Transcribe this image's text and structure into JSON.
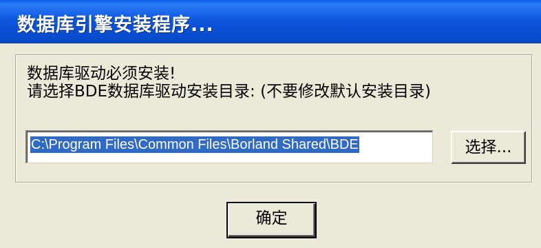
{
  "window": {
    "title": "数据库引擎安装程序..."
  },
  "content": {
    "message_line1": "数据库驱动必须安装!",
    "message_line2": "请选择BDE数据库驱动安装目录: (不要修改默认安装目录)"
  },
  "path_field": {
    "value": "C:\\Program Files\\Common Files\\Borland Shared\\BDE"
  },
  "buttons": {
    "browse_label": "选择...",
    "ok_label": "确定"
  }
}
